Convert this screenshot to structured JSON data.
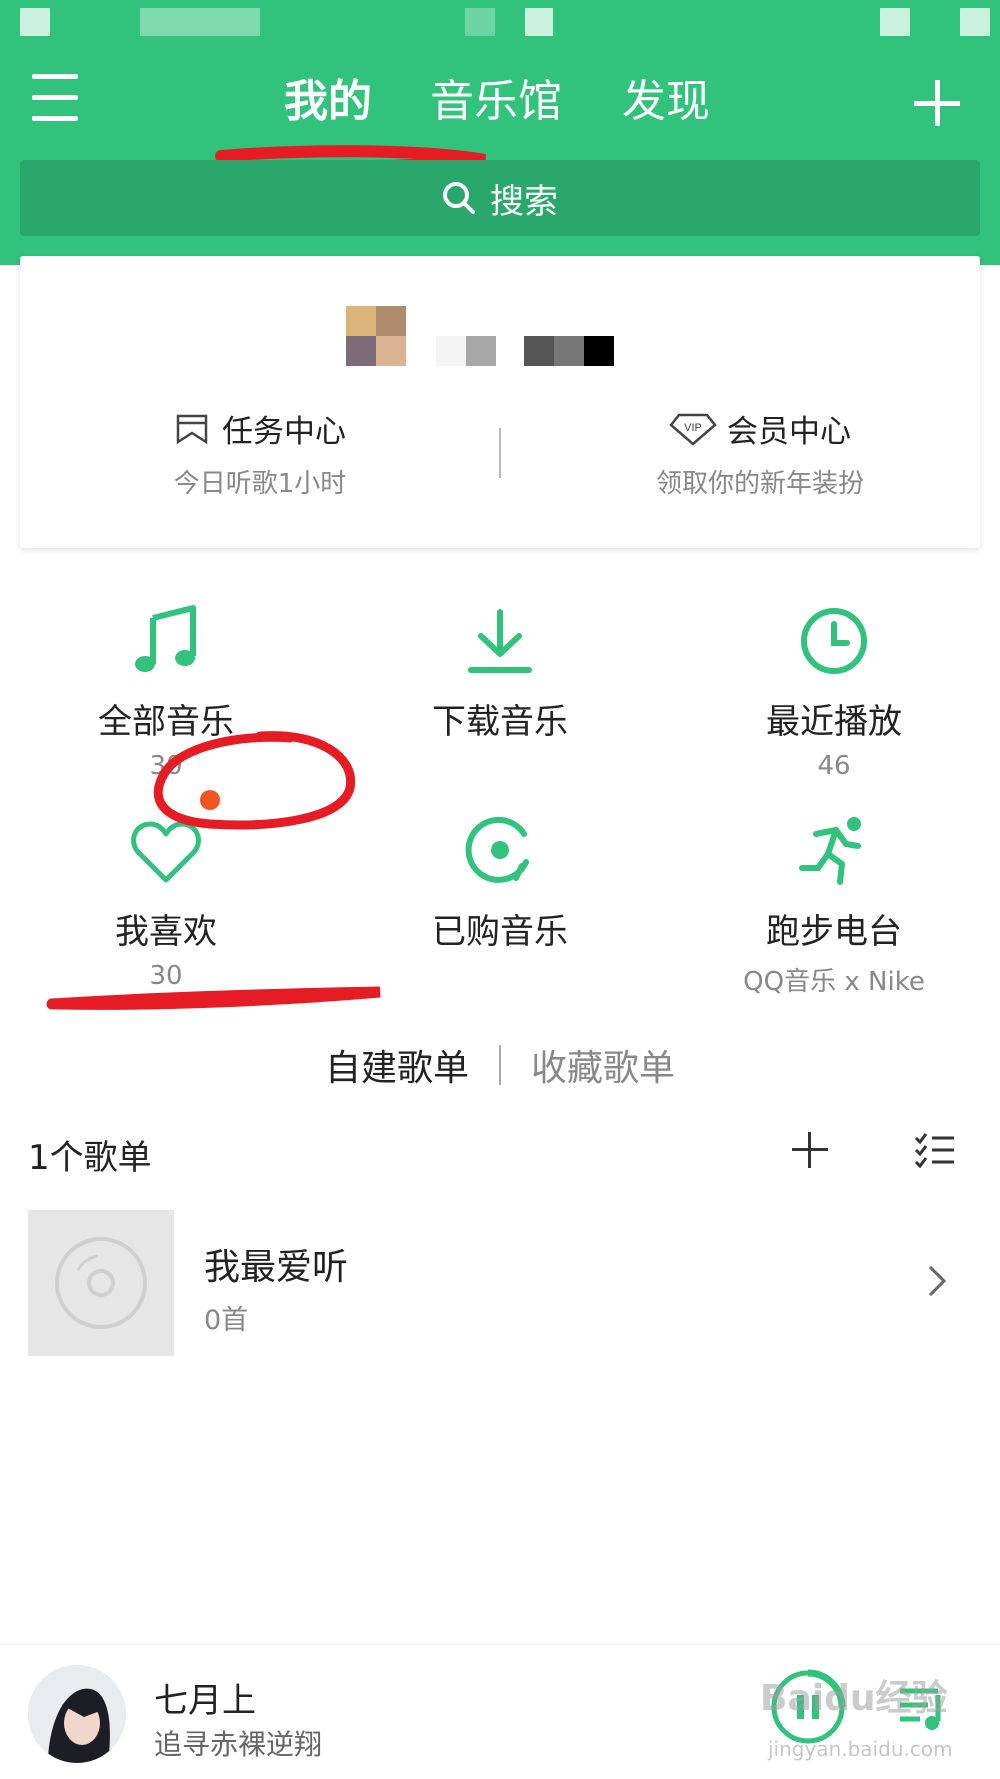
{
  "header": {
    "tabs": [
      {
        "label": "我的",
        "active": true
      },
      {
        "label": "音乐馆",
        "active": false
      },
      {
        "label": "发现",
        "active": false
      }
    ],
    "search_label": "搜索",
    "accent_color": "#31c27c"
  },
  "profile_card": {
    "task_center": {
      "title": "任务中心",
      "subtitle": "今日听歌1小时",
      "icon": "bookmark-icon"
    },
    "vip_center": {
      "title": "会员中心",
      "subtitle": "领取你的新年装扮",
      "icon": "vip-diamond-icon",
      "badge": "VIP"
    }
  },
  "grid": [
    {
      "label": "全部音乐",
      "sub": "30",
      "icon": "music-note-icon"
    },
    {
      "label": "下载音乐",
      "sub": "",
      "icon": "download-icon"
    },
    {
      "label": "最近播放",
      "sub": "46",
      "icon": "clock-icon"
    },
    {
      "label": "我喜欢",
      "sub": "30",
      "icon": "heart-icon"
    },
    {
      "label": "已购音乐",
      "sub": "",
      "icon": "purchased-disc-icon"
    },
    {
      "label": "跑步电台",
      "sub": "QQ音乐 x Nike",
      "icon": "runner-icon"
    }
  ],
  "playlist_tabs": {
    "created": "自建歌单",
    "collected": "收藏歌单"
  },
  "playlists_header": {
    "count_label": "1个歌单"
  },
  "playlists": [
    {
      "name": "我最爱听",
      "count": "0首"
    }
  ],
  "player": {
    "title": "七月上",
    "artist": "追寻赤裸逆翔",
    "watermark": "Baidu经验",
    "watermark_url": "jingyan.baidu.com"
  }
}
